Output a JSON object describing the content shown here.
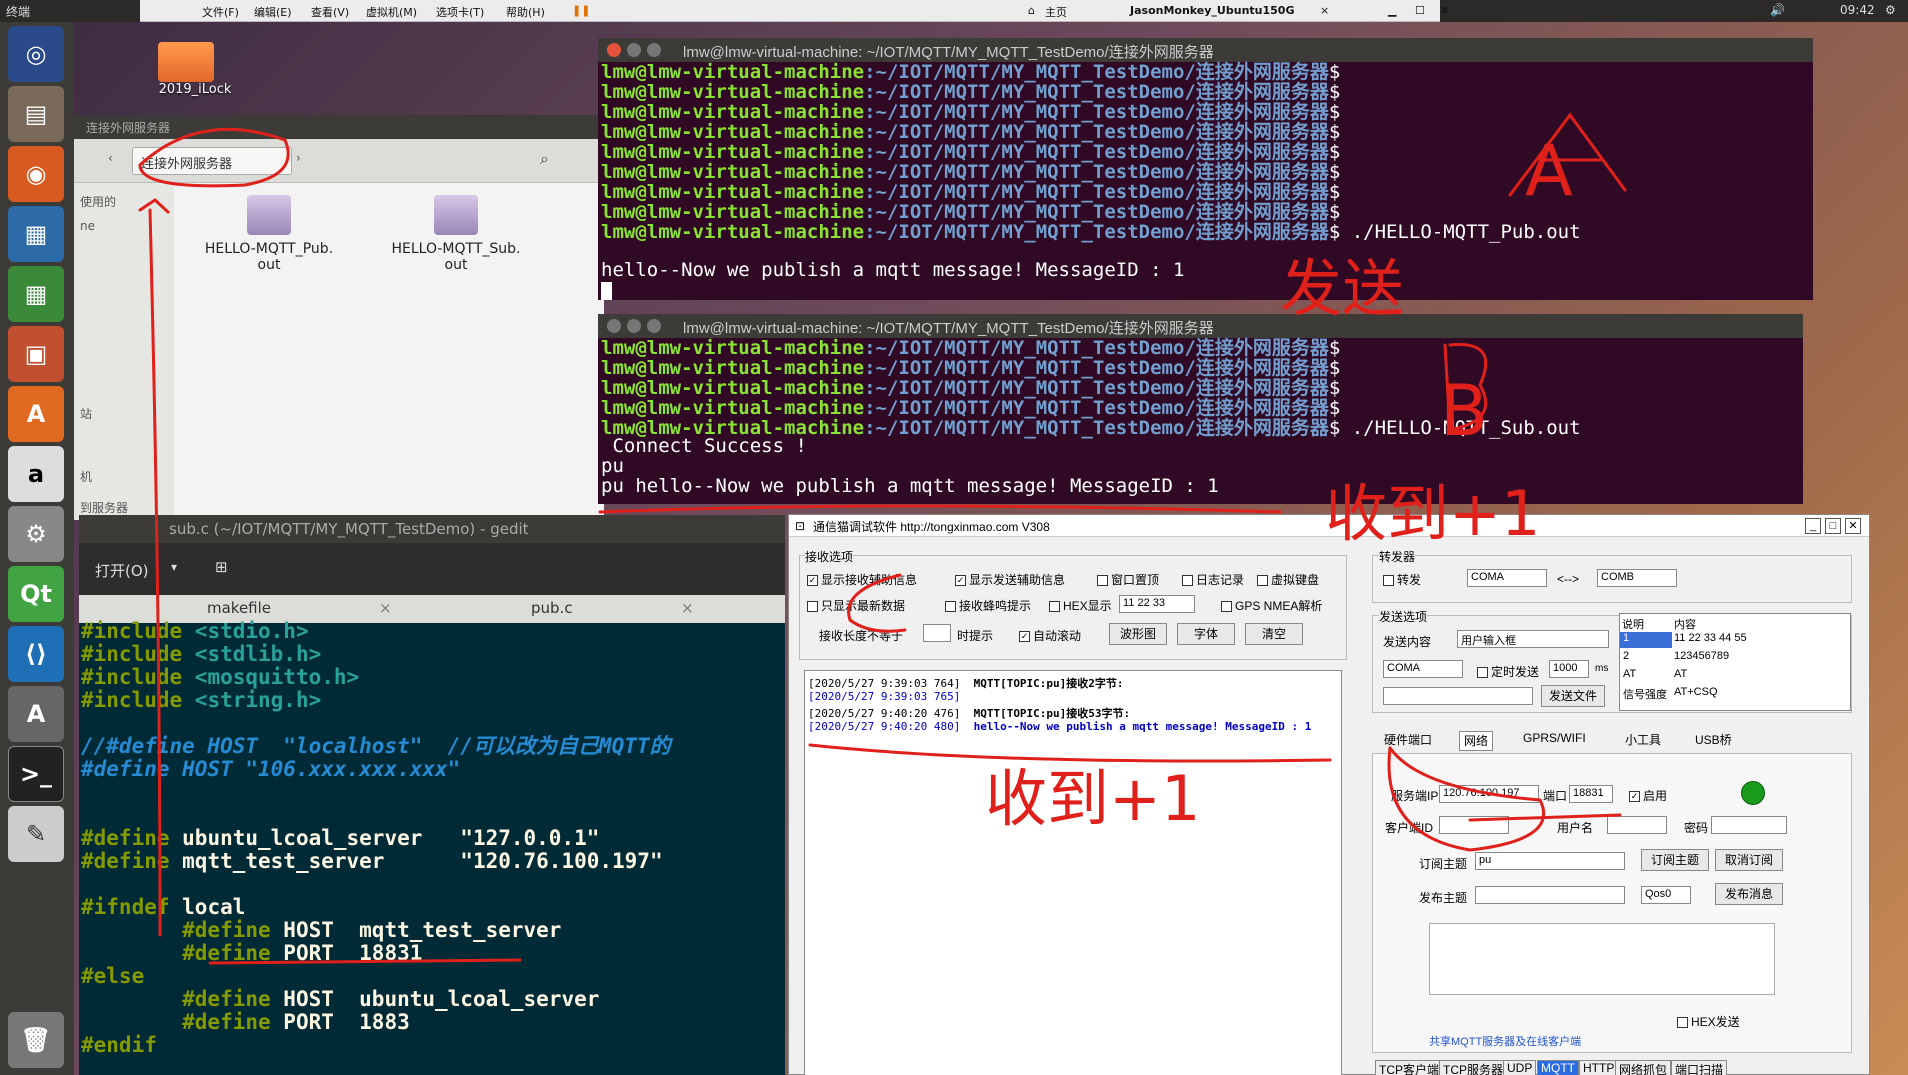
{
  "top_panel": {
    "app_name": "终端",
    "time": "09:42"
  },
  "vm_toolbar": {
    "menus": [
      "文件(F)",
      "编辑(E)",
      "查看(V)",
      "虚拟机(M)",
      "选项卡(T)",
      "帮助(H)"
    ],
    "tab_home": "主页",
    "tab_vm": "JasonMonkey_Ubuntu150G"
  },
  "desktop": {
    "folder_label": "2019_iLock"
  },
  "file_manager": {
    "title": "连接外网服务器",
    "breadcrumb": "连接外网服务器",
    "sidebar_items": [
      "使用的",
      "ne",
      "站",
      "机",
      "到服务器"
    ],
    "files": [
      {
        "name": "HELLO-MQTT_Pub.\nout"
      },
      {
        "name": "HELLO-MQTT_Sub.\nout"
      }
    ]
  },
  "terminal_a": {
    "title": "lmw@lmw-virtual-machine: ~/IOT/MQTT/MY_MQTT_TestDemo/连接外网服务器",
    "user": "lmw@lmw-virtual-machine",
    "path": ":~/IOT/MQTT/MY_MQTT_TestDemo/连接外网服务器",
    "prompt_end": "$",
    "command": " ./HELLO-MQTT_Pub.out",
    "output": "hello--Now we publish a mqtt message! MessageID : 1"
  },
  "terminal_b": {
    "title": "lmw@lmw-virtual-machine: ~/IOT/MQTT/MY_MQTT_TestDemo/连接外网服务器",
    "command": " ./HELLO-MQTT_Sub.out",
    "output": [
      " Connect Success !",
      "pu",
      "pu hello--Now we publish a mqtt message! MessageID : 1"
    ]
  },
  "gedit": {
    "title": "sub.c (~/IOT/MQTT/MY_MQTT_TestDemo) - gedit",
    "open_label": "打开(O)",
    "tabs": [
      "makefile",
      "pub.c"
    ],
    "code": [
      {
        "t": "k",
        "s": "#include "
      },
      {
        "t": "s",
        "s": "<stdio.h>"
      }
    ]
  },
  "gedit_lines": [
    [
      "#include ",
      "<stdio.h>"
    ],
    [
      "#include ",
      "<stdlib.h>"
    ],
    [
      "#include ",
      "<mosquitto.h>"
    ],
    [
      "#include ",
      "<string.h>"
    ],
    [
      "//#define HOST  \"localhost\"  //可以改为自己MQTT的",
      ""
    ],
    [
      "#define HOST \"106.xxx.xxx.xxx\"",
      ""
    ],
    [
      "#define ",
      "ubuntu_lcoal_server   \"127.0.0.1\""
    ],
    [
      "#define ",
      "mqtt_test_server      \"120.76.100.197\""
    ],
    [
      "#ifndef ",
      "local"
    ],
    [
      "        #define ",
      "HOST  mqtt_test_server"
    ],
    [
      "        #define ",
      "PORT  18831"
    ],
    [
      "#else",
      ""
    ],
    [
      "        #define ",
      "HOST  ubuntu_lcoal_server"
    ],
    [
      "        #define ",
      "PORT  1883"
    ],
    [
      "#endif",
      ""
    ]
  ],
  "win": {
    "title": "通信猫调试软件  http://tongxinmao.com  V308",
    "recv_group": "接收选项",
    "recv_opts": [
      "显示接收辅助信息",
      "显示发送辅助信息",
      "窗口置顶",
      "日志记录",
      "虚拟键盘"
    ],
    "recv_opts2": [
      "只显示最新数据",
      "接收蜂鸣提示",
      "HEX显示",
      "GPS NMEA解析"
    ],
    "hex_value": "11 22 33",
    "len_label": "接收长度不等于",
    "tip_label": "时提示",
    "autoscroll": "自动滚动",
    "btn_wave": "波形图",
    "btn_font": "字体",
    "btn_clear": "清空",
    "log": [
      {
        "ts": "[2020/5/27 9:39:03 764]",
        "msg": "MQTT[TOPIC:pu]接收2字节:",
        "color": "#000"
      },
      {
        "ts": "[2020/5/27 9:39:03 765]",
        "msg": "",
        "color": "#0000cc"
      },
      {
        "ts": "[2020/5/27 9:40:20 476]",
        "msg": "MQTT[TOPIC:pu]接收53字节:",
        "color": "#000"
      },
      {
        "ts": "[2020/5/27 9:40:20 480]",
        "msg": "hello--Now we publish a mqtt message! MessageID : 1",
        "color": "#0000cc"
      }
    ],
    "fwd_group": "转发器",
    "fwd_label": "转发",
    "fwd_from": "COMA",
    "fwd_arrow": "<-->",
    "fwd_to": "COMB",
    "send_group": "发送选项",
    "send_content_label": "发送内容",
    "send_content_value": "用户输入框",
    "send_port": "COMA",
    "timed_send": "定时发送",
    "interval": "1000",
    "ms": "ms",
    "send_file": "发送文件",
    "table_headers": [
      "说明",
      "内容"
    ],
    "table_rows": [
      [
        "1",
        "11 22 33 44 55"
      ],
      [
        "2",
        "123456789"
      ],
      [
        "AT",
        "AT"
      ],
      [
        "信号强度",
        "AT+CSQ"
      ]
    ],
    "nav_tabs": [
      "硬件端口",
      "网络",
      "GPRS/WIFI",
      "小工具",
      "USB桥"
    ],
    "server_ip_label": "服务端IP",
    "server_ip": "120.76.100.197",
    "port_label": "端口",
    "port": "18831",
    "enable_label": "启用",
    "client_id_label": "客户端ID",
    "username_label": "用户名",
    "password_label": "密码",
    "subscribe_label": "订阅主题",
    "subscribe_value": "pu",
    "subscribe_btn": "订阅主题",
    "unsubscribe_btn": "取消订阅",
    "publish_label": "发布主题",
    "qos": "Qos0",
    "publish_btn": "发布消息",
    "hex_send": "HEX发送",
    "share_link": "共享MQTT服务器及在线客户端",
    "bottom_tabs": [
      "TCP客户端",
      "TCP服务器",
      "UDP",
      "MQTT",
      "HTTP",
      "网络抓包",
      "端口扫描"
    ]
  },
  "annotations": {
    "a": "A",
    "b": "B",
    "send": "发送",
    "recv1": "收到+1",
    "recv2": "收到+1"
  }
}
